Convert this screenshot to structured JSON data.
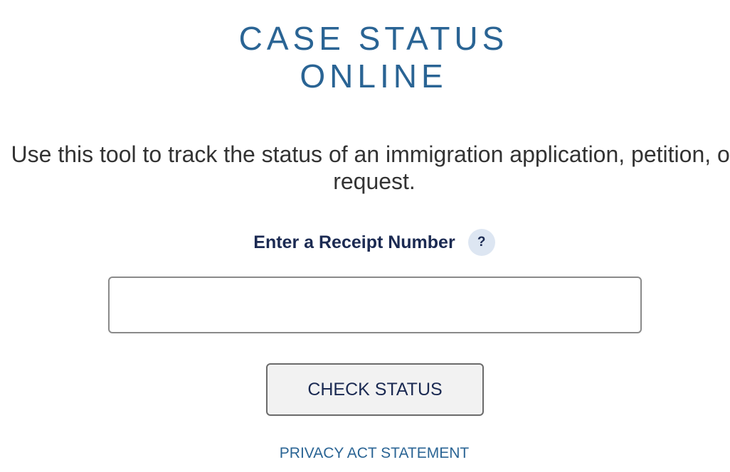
{
  "header": {
    "title_line1": "CASE STATUS",
    "title_line2": "ONLINE"
  },
  "intro": {
    "text": "Use this tool to track the status of an immigration application, petition, or request."
  },
  "receipt": {
    "label": "Enter a Receipt Number",
    "help_icon": "question-mark-icon",
    "help_glyph": "?",
    "input_value": "",
    "input_placeholder": ""
  },
  "actions": {
    "check_status_label": "CHECK STATUS",
    "privacy_link_label": "PRIVACY ACT STATEMENT"
  },
  "colors": {
    "title": "#2a6494",
    "label": "#1b2a52",
    "body_text": "#333333",
    "help_icon_bg": "#dde6f2",
    "button_bg": "#f2f2f2",
    "link": "#2a6494"
  }
}
